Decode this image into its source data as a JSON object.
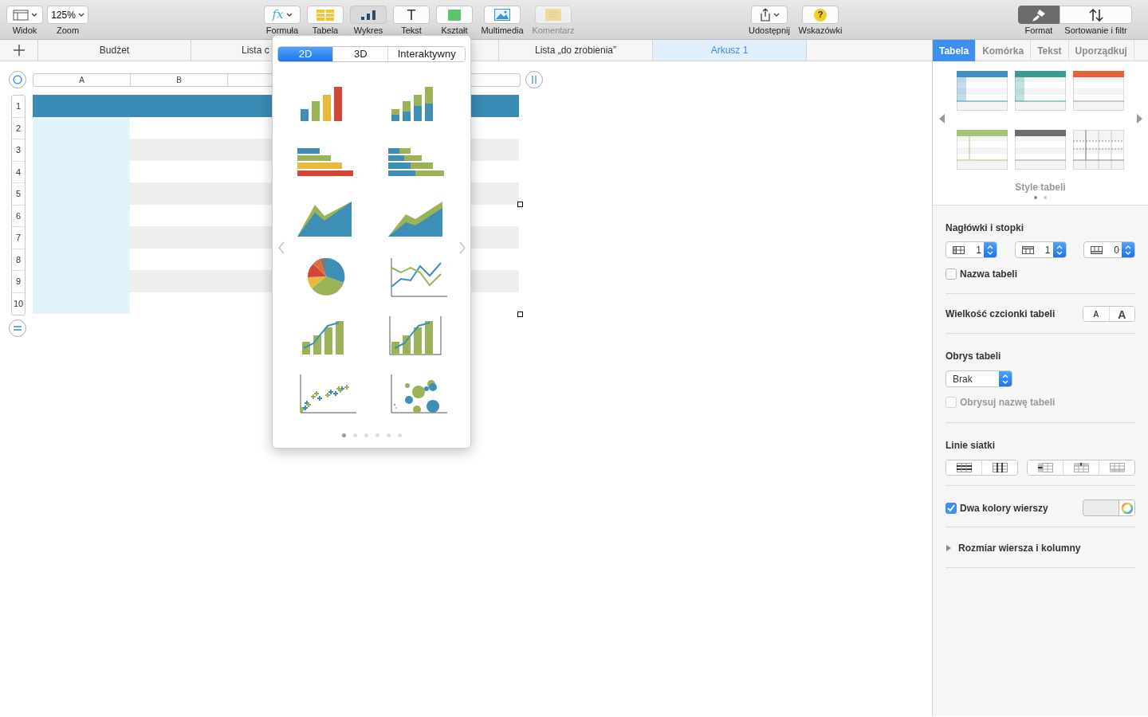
{
  "toolbar": {
    "left": [
      {
        "kind": "view",
        "label": "Widok",
        "active": false,
        "disabled": false
      },
      {
        "kind": "zoom",
        "label": "Zoom",
        "value": "125%",
        "active": false,
        "disabled": false
      }
    ],
    "center": [
      {
        "kind": "formula",
        "label": "Formuła",
        "glyph": "fx",
        "active": false,
        "disabled": false
      },
      {
        "kind": "table",
        "label": "Tabela",
        "active": false,
        "disabled": false
      },
      {
        "kind": "chart",
        "label": "Wykres",
        "active": true,
        "disabled": false
      },
      {
        "kind": "text",
        "label": "Tekst",
        "glyph": "T",
        "active": false,
        "disabled": false
      },
      {
        "kind": "shape",
        "label": "Kształt",
        "active": false,
        "disabled": false
      },
      {
        "kind": "media",
        "label": "Multimedia",
        "active": false,
        "disabled": false
      },
      {
        "kind": "comment",
        "label": "Komentarz",
        "active": false,
        "disabled": true
      }
    ],
    "right": [
      {
        "kind": "share",
        "label": "Udostępnij",
        "active": false,
        "disabled": false
      },
      {
        "kind": "tips",
        "label": "Wskazówki",
        "glyph": "?",
        "active": false,
        "disabled": false
      }
    ],
    "inspector": [
      {
        "kind": "format",
        "label": "Format",
        "selected": true
      },
      {
        "kind": "sort",
        "label": "Sortowanie i filtr",
        "selected": false
      }
    ]
  },
  "sheet_tabs": [
    {
      "label": "Budżet",
      "selected": false
    },
    {
      "label": "Lista c",
      "selected": false
    },
    {
      "label": "Lista „do zrobienia”",
      "selected": false
    },
    {
      "label": "Arkusz 1",
      "selected": true
    }
  ],
  "sheet": {
    "columns": [
      "A",
      "B"
    ],
    "rows": [
      "1",
      "2",
      "3",
      "4",
      "5",
      "6",
      "7",
      "8",
      "9",
      "10"
    ]
  },
  "chart_popover": {
    "segments": [
      {
        "label": "2D",
        "selected": true
      },
      {
        "label": "3D",
        "selected": false
      },
      {
        "label": "Interaktywny",
        "selected": false
      }
    ],
    "chart_types": [
      {
        "kind": "column"
      },
      {
        "kind": "stacked-column"
      },
      {
        "kind": "bar"
      },
      {
        "kind": "stacked-bar"
      },
      {
        "kind": "area"
      },
      {
        "kind": "stacked-area"
      },
      {
        "kind": "pie"
      },
      {
        "kind": "line"
      },
      {
        "kind": "mixed"
      },
      {
        "kind": "two-axis"
      },
      {
        "kind": "scatter"
      },
      {
        "kind": "bubble"
      }
    ],
    "pages": [
      {
        "selected": true
      },
      {
        "selected": false
      },
      {
        "selected": false
      },
      {
        "selected": false
      },
      {
        "selected": false
      },
      {
        "selected": false
      }
    ]
  },
  "inspector": {
    "tabs": [
      {
        "label": "Tabela",
        "selected": true
      },
      {
        "label": "Komórka",
        "selected": false
      },
      {
        "label": "Tekst",
        "selected": false
      },
      {
        "label": "Uporządkuj",
        "selected": false
      }
    ],
    "table_styles": [
      {
        "kind": "header-column",
        "color": "#3d8fbf"
      },
      {
        "kind": "header-column",
        "color": "#3b9a8e"
      },
      {
        "kind": "header",
        "color": "#e8603c"
      },
      {
        "kind": "header-line",
        "color": "#a6c57a"
      },
      {
        "kind": "header",
        "color": "#6d6d6d"
      },
      {
        "kind": "grid"
      }
    ],
    "styles_label": "Style tabeli",
    "style_pages": [
      {
        "selected": true
      },
      {
        "selected": false
      }
    ],
    "headers_title": "Nagłówki i stopki",
    "steppers": [
      {
        "kind": "header-rows",
        "value": "1"
      },
      {
        "kind": "header-columns",
        "value": "1"
      },
      {
        "kind": "footer-rows",
        "value": "0"
      }
    ],
    "table_name": {
      "label": "Nazwa tabeli",
      "checked": false,
      "disabled": false
    },
    "font_size_label": "Wielkość czcionki tabeli",
    "font_size_buttons": [
      "A",
      "A"
    ],
    "outline_title": "Obrys tabeli",
    "outline_value": "Brak",
    "outline_name": {
      "label": "Obrysuj nazwę tabeli",
      "checked": false,
      "disabled": true
    },
    "gridlines_title": "Linie siatki",
    "alternating": {
      "label": "Dwa kolory wierszy",
      "checked": true,
      "disabled": false
    },
    "row_size": {
      "label": "Rozmiar wiersza i kolumny",
      "expanded": false
    }
  }
}
